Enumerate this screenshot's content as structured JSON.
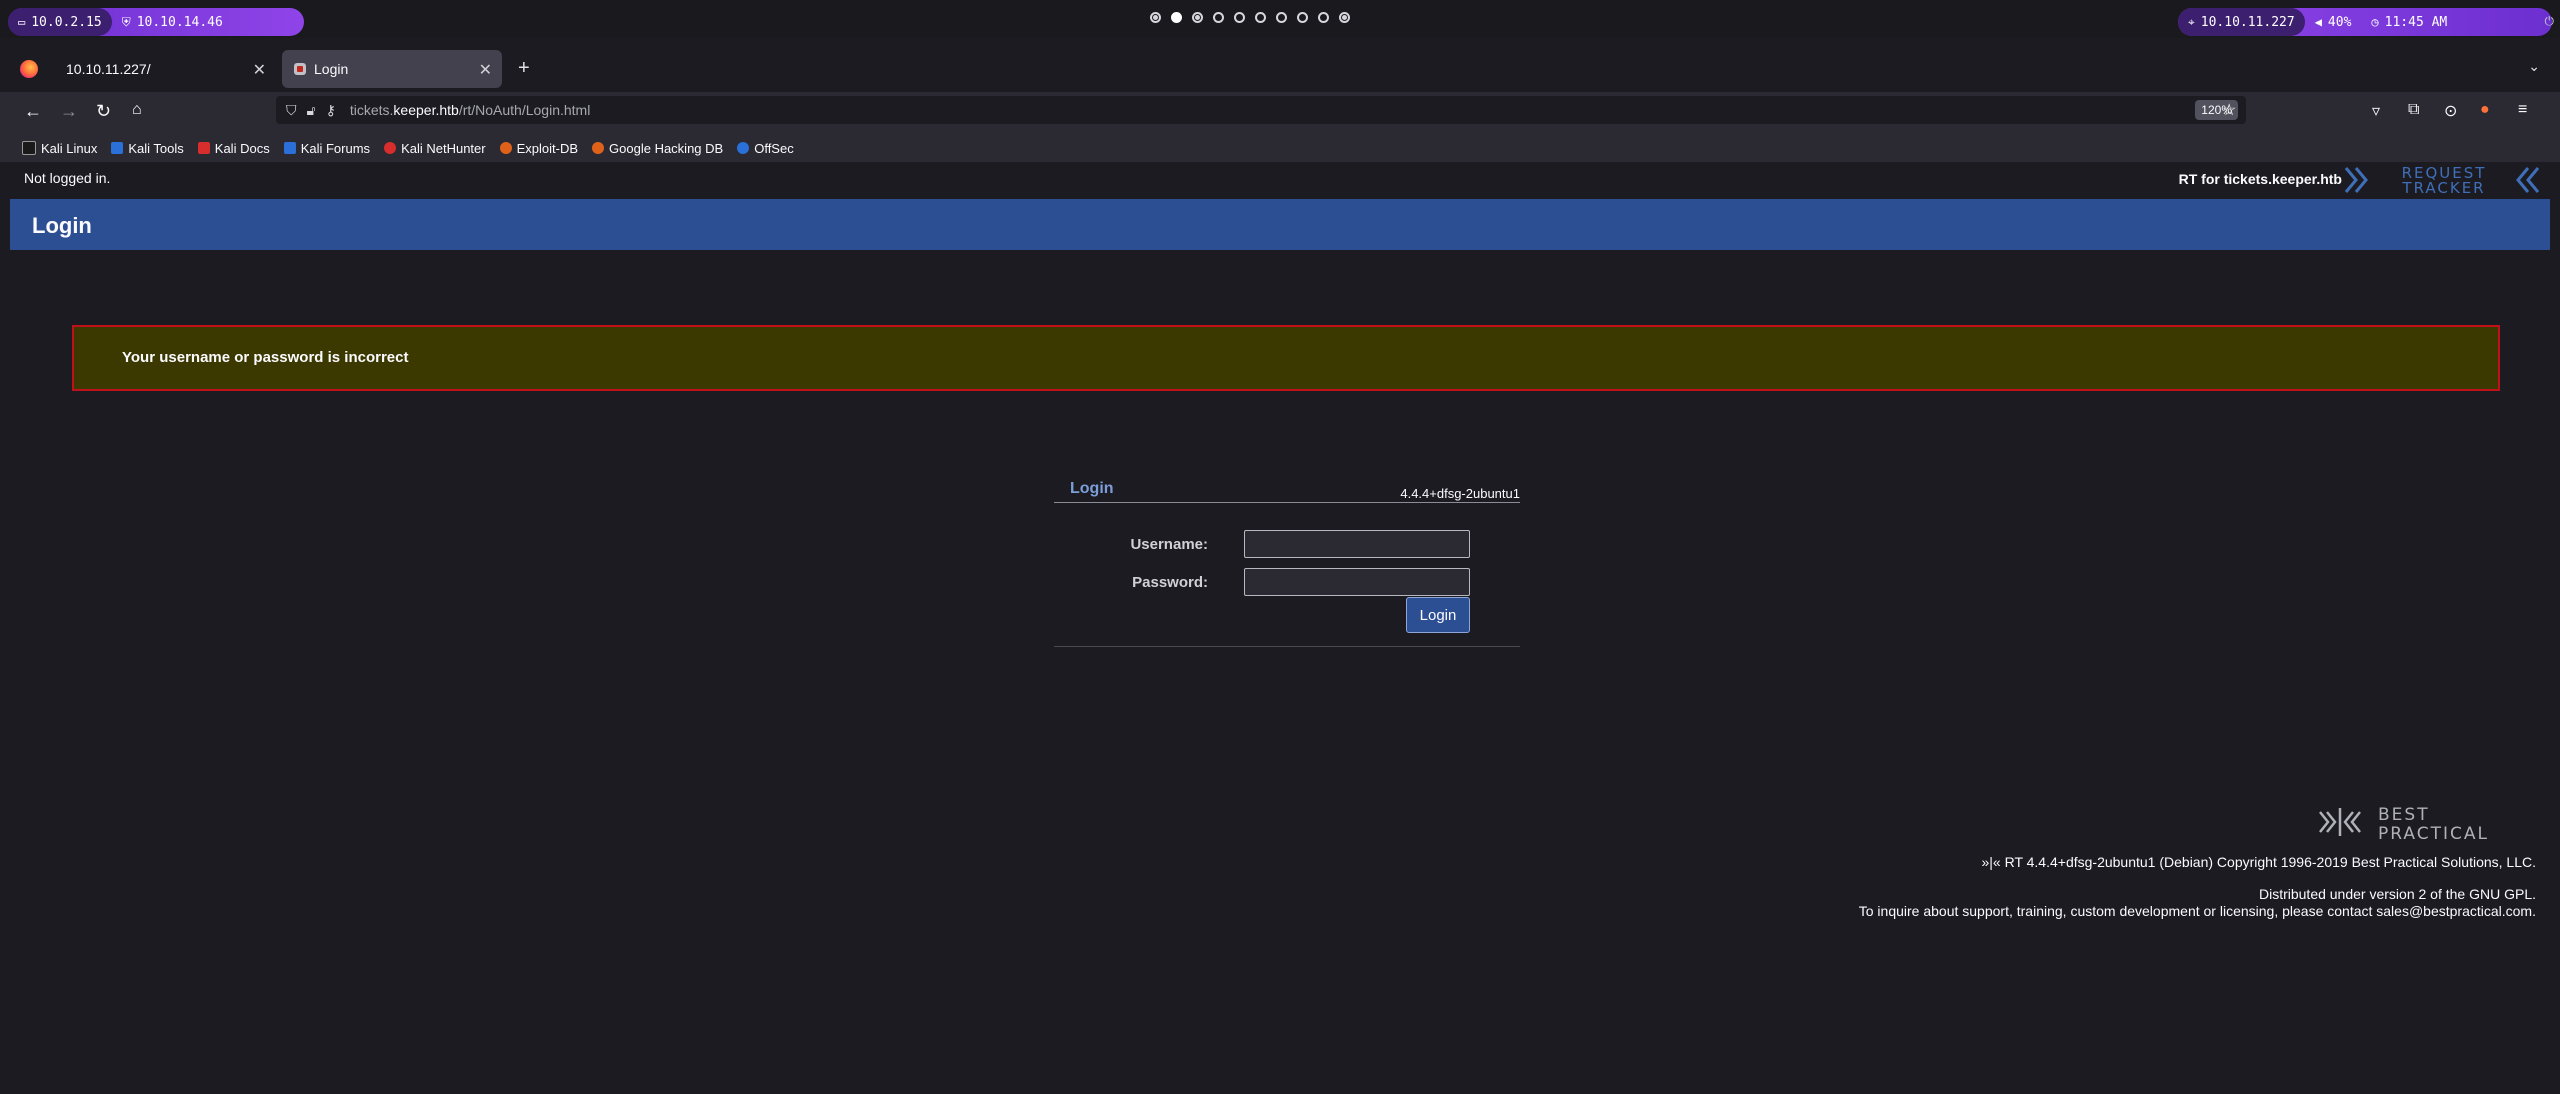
{
  "system_panel": {
    "left_ip_1": "10.0.2.15",
    "left_ip_2": "10.10.14.46",
    "target_ip": "10.10.11.227",
    "volume": "40%",
    "clock": "11:45 AM"
  },
  "tabs": [
    {
      "label": "10.10.11.227/"
    },
    {
      "label": "Login"
    }
  ],
  "urlbar": {
    "host_prefix": "tickets.",
    "host_domain": "keeper.htb",
    "path": "/rt/NoAuth/Login.html",
    "zoom": "120%"
  },
  "bookmarks": [
    {
      "label": "Kali Linux",
      "color": "#1a1a1a"
    },
    {
      "label": "Kali Tools",
      "color": "#2b6fd8"
    },
    {
      "label": "Kali Docs",
      "color": "#d72d2d"
    },
    {
      "label": "Kali Forums",
      "color": "#2b6fd8"
    },
    {
      "label": "Kali NetHunter",
      "color": "#d72d2d"
    },
    {
      "label": "Exploit-DB",
      "color": "#e0621a"
    },
    {
      "label": "Google Hacking DB",
      "color": "#e0621a"
    },
    {
      "label": "OffSec",
      "color": "#2b6fd8"
    }
  ],
  "page": {
    "login_status": "Not logged in.",
    "rt_for": "RT for tickets.keeper.htb",
    "rt_logo_line1": "REQUEST",
    "rt_logo_line2": "TRACKER",
    "header_title": "Login",
    "error_message": "Your username or password is incorrect",
    "login_box": {
      "title": "Login",
      "version": "4.4.4+dfsg-2ubuntu1",
      "username_label": "Username:",
      "password_label": "Password:",
      "username_value": "",
      "password_value": "",
      "submit_label": "Login"
    },
    "footer": {
      "bp_logo_line1": "BEST",
      "bp_logo_line2": "PRACTICAL",
      "copyright": "»|« RT 4.4.4+dfsg-2ubuntu1 (Debian) Copyright 1996-2019 Best Practical Solutions, LLC.",
      "license": "Distributed under version 2 of the GNU GPL.",
      "contact": "To inquire about support, training, custom development or licensing, please contact sales@bestpractical.com."
    }
  },
  "colors": {
    "header_blue": "#2c4f93",
    "error_bg": "#3b3800",
    "error_border": "#c0101a",
    "accent_purple": "#8f44e8"
  }
}
